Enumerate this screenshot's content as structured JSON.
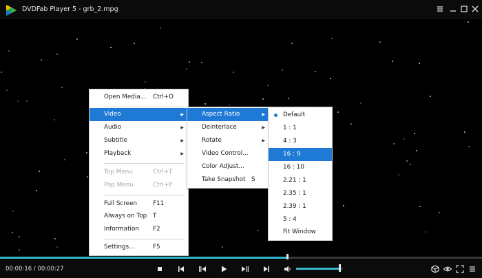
{
  "window": {
    "title": "DVDFab Player 5 - grb_2.mpg",
    "controls": [
      "settings-icon",
      "minimize-icon",
      "restore-icon",
      "close-icon"
    ]
  },
  "main_menu": {
    "items": [
      {
        "label": "Open Media...",
        "shortcut": "Ctrl+O"
      },
      {
        "label": "Video",
        "submenu": true,
        "selected": true
      },
      {
        "label": "Audio",
        "submenu": true
      },
      {
        "label": "Subtitle",
        "submenu": true
      },
      {
        "label": "Playback",
        "submenu": true
      },
      {
        "label": "Top Menu",
        "shortcut": "Ctrl+T",
        "disabled": true
      },
      {
        "label": "Pop Menu",
        "shortcut": "Ctrl+P",
        "disabled": true
      },
      {
        "label": "Full Screen",
        "shortcut": "F11"
      },
      {
        "label": "Always on Top",
        "shortcut": "T"
      },
      {
        "label": "Information",
        "shortcut": "F2"
      },
      {
        "label": "Settings...",
        "shortcut": "F5"
      }
    ]
  },
  "video_menu": {
    "items": [
      {
        "label": "Aspect Ratio",
        "submenu": true,
        "selected": true
      },
      {
        "label": "Deinterlace",
        "submenu": true
      },
      {
        "label": "Rotate",
        "submenu": true
      },
      {
        "label": "Video Control..."
      },
      {
        "label": "Color Adjust..."
      },
      {
        "label": "Take Snapshot",
        "shortcut": "S"
      }
    ]
  },
  "aspect_menu": {
    "items": [
      {
        "label": "Default",
        "checked": true
      },
      {
        "label": "1 : 1"
      },
      {
        "label": "4 : 3"
      },
      {
        "label": "16 : 9",
        "highlighted": true
      },
      {
        "label": "16 : 10"
      },
      {
        "label": "2.21 : 1"
      },
      {
        "label": "2.35 : 1"
      },
      {
        "label": "2.39 : 1"
      },
      {
        "label": "5 : 4"
      },
      {
        "label": "Fit Window"
      }
    ]
  },
  "playback": {
    "time_text": "00:00:16 / 00:00:27",
    "progress_fraction": 0.595,
    "volume_fraction": 0.92,
    "accent_color": "#37b8cf",
    "highlight_color": "#1f7ad6"
  },
  "controls": [
    "stop-icon",
    "previous-icon",
    "step-back-icon",
    "play-icon",
    "step-forward-icon",
    "next-icon",
    "volume-icon",
    "3d-icon",
    "eye-icon",
    "fullscreen-icon",
    "menu-icon"
  ]
}
